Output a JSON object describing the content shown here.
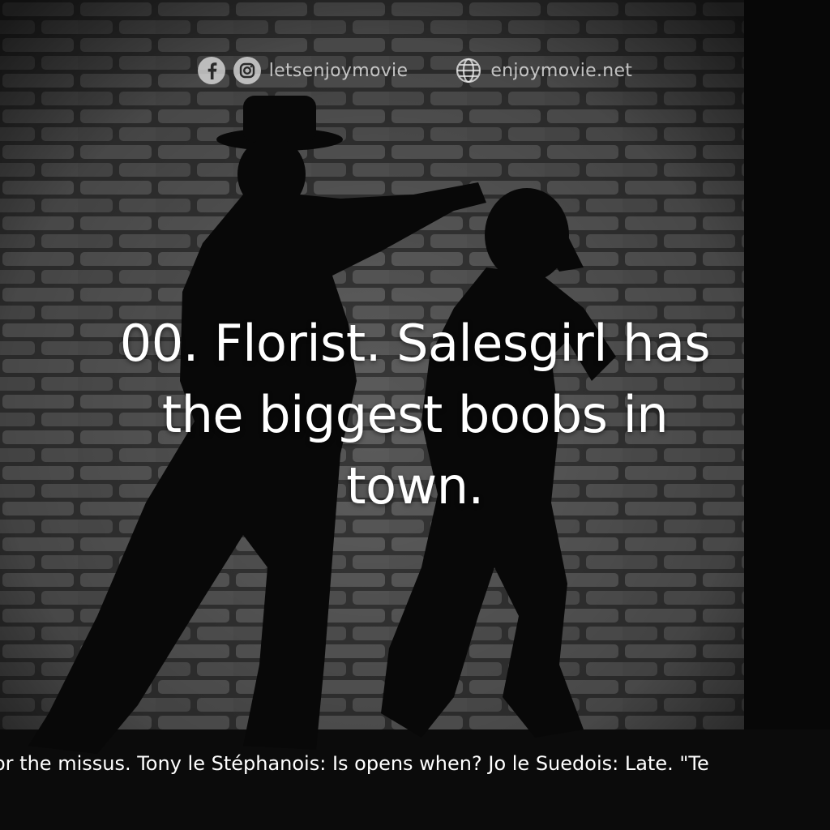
{
  "header": {
    "facebook_icon": "facebook-icon",
    "instagram_icon": "instagram-icon",
    "social_handle": "letsenjoymovie",
    "globe_icon": "globe-icon",
    "website": "enjoymovie.net"
  },
  "quote": {
    "text": "00. Florist. Salesgirl has the biggest boobs in town."
  },
  "ticker": {
    "text": "or the missus. Tony le Stéphanois: Is opens when? Jo le Suedois: Late. \"Te"
  },
  "colors": {
    "text": "#ffffff",
    "header_text": "#e0e0e0",
    "background": "#141414"
  }
}
